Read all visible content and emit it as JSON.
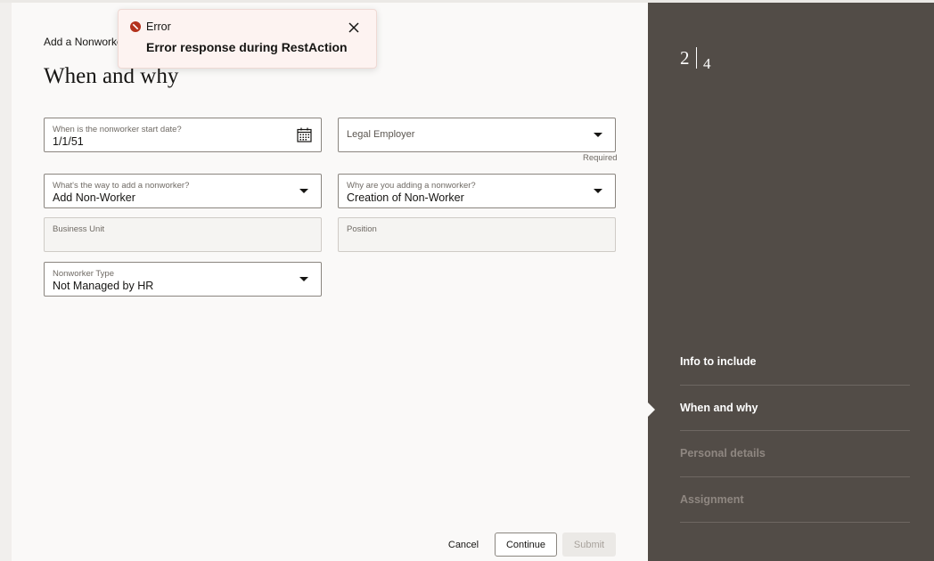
{
  "page": {
    "subtitle": "Add a Nonworker",
    "title": "When and why"
  },
  "toast": {
    "title": "Error",
    "message": "Error response during RestAction"
  },
  "form": {
    "start_date": {
      "label": "When is the nonworker start date?",
      "value": "1/1/51"
    },
    "legal_employer": {
      "placeholder": "Legal Employer",
      "hint": "Required"
    },
    "way_to_add": {
      "label": "What's the way to add a nonworker?",
      "value": "Add Non-Worker"
    },
    "reason": {
      "label": "Why are you adding a nonworker?",
      "value": "Creation of Non-Worker"
    },
    "business_unit": {
      "label": "Business Unit",
      "value": ""
    },
    "position": {
      "label": "Position",
      "value": ""
    },
    "nonworker_type": {
      "label": "Nonworker Type",
      "value": "Not Managed by HR"
    }
  },
  "buttons": {
    "cancel": "Cancel",
    "continue": "Continue",
    "submit": "Submit"
  },
  "progress": {
    "current": "2",
    "total": "4",
    "steps": [
      {
        "label": "Info to include",
        "state": "done"
      },
      {
        "label": "When and why",
        "state": "current"
      },
      {
        "label": "Personal details",
        "state": "future"
      },
      {
        "label": "Assignment",
        "state": "future"
      }
    ]
  },
  "colors": {
    "side_panel": "#524c47",
    "error": "#b3311c",
    "toast_bg": "#fdf3f1"
  }
}
